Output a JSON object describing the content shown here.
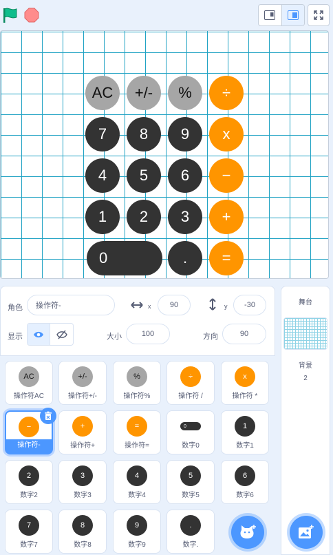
{
  "toolbar": {
    "flag_icon": "green-flag-icon",
    "stop_icon": "stop-icon",
    "colors": {
      "flag": "#0fbd8c",
      "stop": "#ff8c8c",
      "accent": "#4c97ff"
    }
  },
  "stage": {
    "keys": [
      {
        "label": "AC",
        "style": "gray"
      },
      {
        "label": "+/-",
        "style": "gray"
      },
      {
        "label": "%",
        "style": "gray"
      },
      {
        "label": "÷",
        "style": "orange"
      },
      {
        "label": "7",
        "style": "dark"
      },
      {
        "label": "8",
        "style": "dark"
      },
      {
        "label": "9",
        "style": "dark"
      },
      {
        "label": "x",
        "style": "orange"
      },
      {
        "label": "4",
        "style": "dark"
      },
      {
        "label": "5",
        "style": "dark"
      },
      {
        "label": "6",
        "style": "dark"
      },
      {
        "label": "−",
        "style": "orange"
      },
      {
        "label": "1",
        "style": "dark"
      },
      {
        "label": "2",
        "style": "dark"
      },
      {
        "label": "3",
        "style": "dark"
      },
      {
        "label": "+",
        "style": "orange"
      },
      {
        "label": "0",
        "style": "dark"
      },
      {
        "label": ".",
        "style": "dark"
      },
      {
        "label": "=",
        "style": "orange"
      }
    ]
  },
  "sprite_info": {
    "sprite_label": "角色",
    "sprite_name": "操作符-",
    "x_label": "x",
    "x_value": "90",
    "y_label": "y",
    "y_value": "-30",
    "show_label": "显示",
    "size_label": "大小",
    "size_value": "100",
    "direction_label": "方向",
    "direction_value": "90"
  },
  "sprites": [
    {
      "name": "操作符AC",
      "thumb": "AC",
      "style": "gray"
    },
    {
      "name": "操作符+/-",
      "thumb": "+/-",
      "style": "gray"
    },
    {
      "name": "操作符%",
      "thumb": "%",
      "style": "gray"
    },
    {
      "name": "操作符 /",
      "thumb": "÷",
      "style": "orange"
    },
    {
      "name": "操作符 *",
      "thumb": "x",
      "style": "orange"
    },
    {
      "name": "操作符-",
      "thumb": "−",
      "style": "orange",
      "selected": true
    },
    {
      "name": "操作符+",
      "thumb": "+",
      "style": "orange"
    },
    {
      "name": "操作符=",
      "thumb": "=",
      "style": "orange"
    },
    {
      "name": "数字0",
      "thumb": "0",
      "style": "pill"
    },
    {
      "name": "数字1",
      "thumb": "1",
      "style": "dark"
    },
    {
      "name": "数字2",
      "thumb": "2",
      "style": "dark"
    },
    {
      "name": "数字3",
      "thumb": "3",
      "style": "dark"
    },
    {
      "name": "数字4",
      "thumb": "4",
      "style": "dark"
    },
    {
      "name": "数字5",
      "thumb": "5",
      "style": "dark"
    },
    {
      "name": "数字6",
      "thumb": "6",
      "style": "dark"
    },
    {
      "name": "数字7",
      "thumb": "7",
      "style": "dark"
    },
    {
      "name": "数字8",
      "thumb": "8",
      "style": "dark"
    },
    {
      "name": "数字9",
      "thumb": "9",
      "style": "dark"
    },
    {
      "name": "数字.",
      "thumb": ".",
      "style": "dark"
    }
  ],
  "stage_panel": {
    "title": "舞台",
    "backdrops_label": "背景",
    "backdrops_count": "2"
  }
}
